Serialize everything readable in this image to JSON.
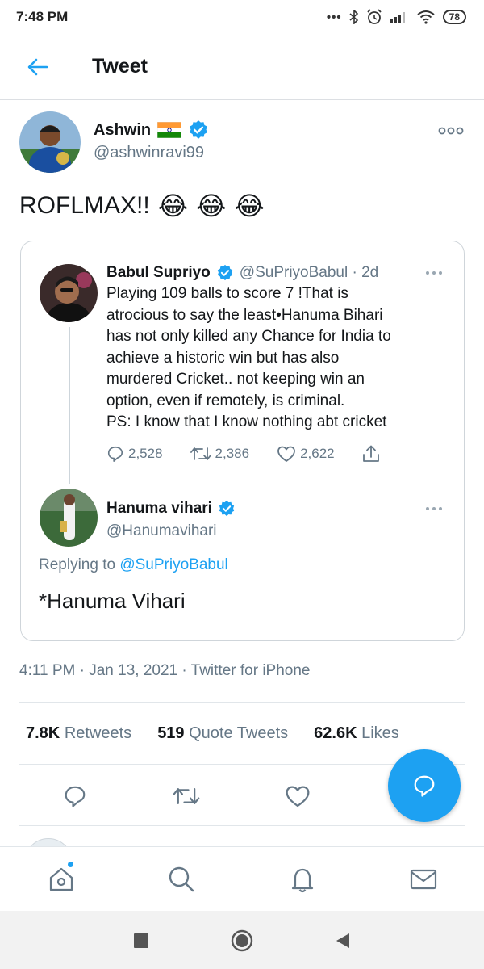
{
  "status_bar": {
    "time": "7:48 PM",
    "battery": "78"
  },
  "header": {
    "title": "Tweet"
  },
  "tweet": {
    "author_name": "Ashwin",
    "author_handle": "@ashwinravi99",
    "text": "ROFLMAX!!",
    "emoji": [
      "😂",
      "😂",
      "😂"
    ],
    "timestamp": "4:11 PM · Jan 13, 2021 · Twitter for iPhone"
  },
  "quoted": {
    "first": {
      "name": "Babul Supriyo",
      "handle_time": "@SuPriyoBabul · 2d",
      "lines": [
        "Playing 109 balls to score 7 !That is",
        "atrocious to say the least•Hanuma Bihari",
        "has not only killed any Chance for India to",
        "achieve a historic win but has also",
        "murdered Cricket.. not keeping win an",
        "option, even if remotely, is criminal.",
        "PS: I know that I know nothing abt cricket"
      ],
      "replies": "2,528",
      "retweets": "2,386",
      "likes": "2,622"
    },
    "second": {
      "name": "Hanuma vihari",
      "handle": "@Hanumavihari",
      "replying_prefix": "Replying to",
      "replying_to": "@SuPriyoBabul",
      "text": "*Hanuma Vihari"
    }
  },
  "stats": {
    "retweets_num": "7.8K",
    "retweets_label": "Retweets",
    "quotes_num": "519",
    "quotes_label": "Quote Tweets",
    "likes_num": "62.6K",
    "likes_label": "Likes"
  },
  "colors": {
    "accent": "#1da1f2",
    "muted": "#657786",
    "text": "#14171a"
  }
}
